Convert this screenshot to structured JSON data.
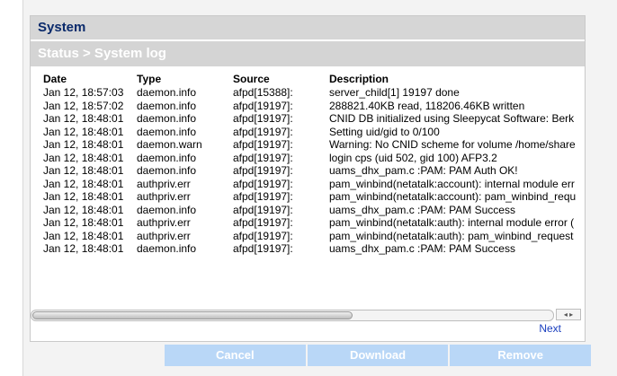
{
  "window": {
    "section_title": "System",
    "breadcrumb": "Status > System log"
  },
  "log_table": {
    "headers": {
      "date": "Date",
      "type": "Type",
      "source": "Source",
      "description": "Description"
    },
    "rows": [
      {
        "date": "Jan 12, 18:57:03",
        "type": "daemon.info",
        "source": "afpd[15388]:",
        "description": "server_child[1] 19197 done"
      },
      {
        "date": "Jan 12, 18:57:02",
        "type": "daemon.info",
        "source": "afpd[19197]:",
        "description": "288821.40KB read, 118206.46KB written"
      },
      {
        "date": "Jan 12, 18:48:01",
        "type": "daemon.info",
        "source": "afpd[19197]:",
        "description": "CNID DB initialized using Sleepycat Software: Berk"
      },
      {
        "date": "Jan 12, 18:48:01",
        "type": "daemon.info",
        "source": "afpd[19197]:",
        "description": "Setting uid/gid to 0/100"
      },
      {
        "date": "Jan 12, 18:48:01",
        "type": "daemon.warn",
        "source": "afpd[19197]:",
        "description": "Warning: No CNID scheme for volume /home/share"
      },
      {
        "date": "Jan 12, 18:48:01",
        "type": "daemon.info",
        "source": "afpd[19197]:",
        "description": "login cps (uid 502, gid 100) AFP3.2"
      },
      {
        "date": "Jan 12, 18:48:01",
        "type": "daemon.info",
        "source": "afpd[19197]:",
        "description": "uams_dhx_pam.c :PAM: PAM Auth OK!"
      },
      {
        "date": "Jan 12, 18:48:01",
        "type": "authpriv.err",
        "source": "afpd[19197]:",
        "description": "pam_winbind(netatalk:account): internal module err"
      },
      {
        "date": "Jan 12, 18:48:01",
        "type": "authpriv.err",
        "source": "afpd[19197]:",
        "description": "pam_winbind(netatalk:account): pam_winbind_requ"
      },
      {
        "date": "Jan 12, 18:48:01",
        "type": "daemon.info",
        "source": "afpd[19197]:",
        "description": "uams_dhx_pam.c :PAM: PAM Success"
      },
      {
        "date": "Jan 12, 18:48:01",
        "type": "authpriv.err",
        "source": "afpd[19197]:",
        "description": "pam_winbind(netatalk:auth): internal module error ("
      },
      {
        "date": "Jan 12, 18:48:01",
        "type": "authpriv.err",
        "source": "afpd[19197]:",
        "description": "pam_winbind(netatalk:auth): pam_winbind_request"
      },
      {
        "date": "Jan 12, 18:48:01",
        "type": "daemon.info",
        "source": "afpd[19197]:",
        "description": "uams_dhx_pam.c :PAM: PAM Success"
      }
    ]
  },
  "pagination": {
    "next_label": "Next"
  },
  "scrollbar": {
    "arrows_glyph": "◂ ▸"
  },
  "buttons": {
    "cancel": "Cancel",
    "download": "Download",
    "remove": "Remove"
  },
  "colors": {
    "title_text": "#0a2a6b",
    "header_bar": "#d6d6d6",
    "button_bg": "#b9d7f7",
    "link": "#1a3fbf"
  }
}
